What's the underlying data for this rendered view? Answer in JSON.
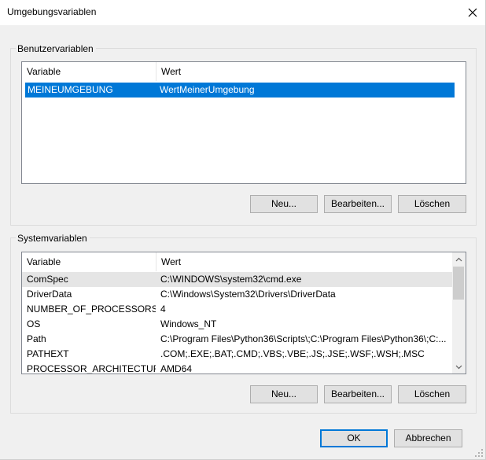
{
  "window": {
    "title": "Umgebungsvariablen",
    "close_icon": "close-icon"
  },
  "user_vars": {
    "group_label": "Benutzervariablen",
    "columns": [
      "Variable",
      "Wert"
    ],
    "rows": [
      {
        "variable": "MEINEUMGEBUNG",
        "value": "WertMeinerUmgebung",
        "selected": true
      }
    ],
    "buttons": {
      "new": "Neu...",
      "edit": "Bearbeiten...",
      "delete": "Löschen"
    }
  },
  "system_vars": {
    "group_label": "Systemvariablen",
    "columns": [
      "Variable",
      "Wert"
    ],
    "rows": [
      {
        "variable": "ComSpec",
        "value": "C:\\WINDOWS\\system32\\cmd.exe"
      },
      {
        "variable": "DriverData",
        "value": "C:\\Windows\\System32\\Drivers\\DriverData"
      },
      {
        "variable": "NUMBER_OF_PROCESSORS",
        "value": "4"
      },
      {
        "variable": "OS",
        "value": "Windows_NT"
      },
      {
        "variable": "Path",
        "value": "C:\\Program Files\\Python36\\Scripts\\;C:\\Program Files\\Python36\\;C:..."
      },
      {
        "variable": "PATHEXT",
        "value": ".COM;.EXE;.BAT;.CMD;.VBS;.VBE;.JS;.JSE;.WSF;.WSH;.MSC"
      },
      {
        "variable": "PROCESSOR_ARCHITECTURE",
        "value": "AMD64"
      }
    ],
    "buttons": {
      "new": "Neu...",
      "edit": "Bearbeiten...",
      "delete": "Löschen"
    }
  },
  "footer": {
    "ok": "OK",
    "cancel": "Abbrechen"
  },
  "colors": {
    "selection": "#0078d7",
    "hover_row": "#e5e5e5",
    "window_bg": "#f0f0f0"
  }
}
